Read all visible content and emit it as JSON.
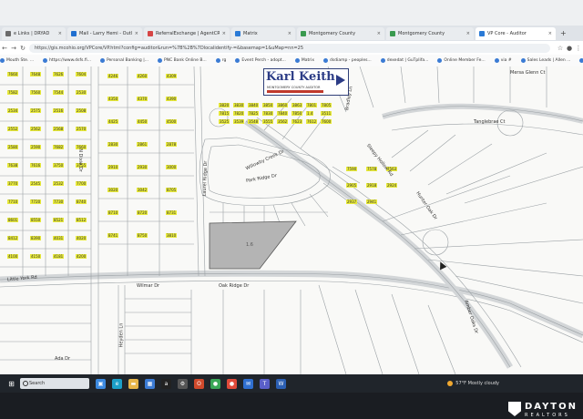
{
  "browser": {
    "top_left_label": "",
    "tabs": [
      {
        "label": "e Links | DRYAD",
        "color": "#6b6b6b"
      },
      {
        "label": "Mail - Larry Hemi - Outlook",
        "color": "#1f6fd0"
      },
      {
        "label": "ReferralExchange | AgentCRM",
        "color": "#d64545"
      },
      {
        "label": "Matrix",
        "color": "#2a7ad6"
      },
      {
        "label": "Montgomery County",
        "color": "#3a9a4f"
      },
      {
        "label": "Montgomery County",
        "color": "#3a9a4f"
      },
      {
        "label": "VP Core - Auditor",
        "color": "#2a7ad6"
      }
    ],
    "active_tab_index": 6,
    "url": "https://gis.mcohio.org/VPCore/VP.html?config=auditor&run=%7B%2B%7Dlocalidentify-=&basemap=1&uMap=nn=25",
    "bookmarks": [
      "Mouth Ste. ...",
      "https://www.dsfs.fi...",
      "Personal Banking |...",
      "PNC Bank Online B...",
      "rg",
      "Event Perch - adopt...",
      "Matrix",
      "dsdiamp - peoples...",
      "dexedat | GuTplifa...",
      "Online Member Fe...",
      "via #",
      "Sales Leads | Allen ...",
      "Lead Offers | Lou...",
      "XGL Mail (7)"
    ]
  },
  "map": {
    "logo": {
      "name": "Karl Keith",
      "subtitle": "MONTGOMERY COUNTY AUDITOR"
    },
    "streets": [
      "Willowby Creek Dr",
      "Park Ridge Dr",
      "Laurel Ridge Dr",
      "Hunter Oak Dr",
      "Sleepy Hollow Rd",
      "Little York Rd",
      "Ada Dr",
      "Heyden Ln",
      "Amber Oaks Dr",
      "Tanglebrae Ct",
      "Mersa Glenn Ct",
      "N Dixie Dr",
      "Bradley Ln",
      "Wilmar Dr",
      "Oak Ridge Dr"
    ],
    "parcel_labels": [
      "7660",
      "7648",
      "7626",
      "7604",
      "7582",
      "7560",
      "7544",
      "2530",
      "2534",
      "2575",
      "2516",
      "2508",
      "2552",
      "2562",
      "2568",
      "2570",
      "2580",
      "2590",
      "7682",
      "7660",
      "7638",
      "7616",
      "3750",
      "3755",
      "3770",
      "2545",
      "2532",
      "7700",
      "7710",
      "7720",
      "7730",
      "8740",
      "8601",
      "8550",
      "8521",
      "8512",
      "8412",
      "8390",
      "4031",
      "4020",
      "4100",
      "4150",
      "4181",
      "4200",
      "4246",
      "4260",
      "4309",
      "4350",
      "4370",
      "4390",
      "4425",
      "4450",
      "4500",
      "2830",
      "2861",
      "2878",
      "2910",
      "2930",
      "3000",
      "3020",
      "3042",
      "8705",
      "8710",
      "8720",
      "8731",
      "8741",
      "8750",
      "3810",
      "3820",
      "3830",
      "3840",
      "3850",
      "3860",
      "3863",
      "7801",
      "7805",
      "7815",
      "7820",
      "7825",
      "7830",
      "7840",
      "7850",
      "1.4",
      "3511",
      "3525",
      "3539",
      "3548",
      "3555",
      "3562",
      "7623",
      "7612",
      "7600",
      "7590",
      "7578",
      "7563",
      "2905",
      "2918",
      "2924",
      "2937",
      "2941"
    ],
    "highlighted_parcel": {
      "label": "1.6",
      "color": "#b4b4b4"
    }
  },
  "taskbar": {
    "search_placeholder": "Search",
    "weather": "57°F  Mostly cloudy",
    "apps": [
      {
        "name": "task-view-icon",
        "color": "#3c8ae0",
        "glyph": "▣"
      },
      {
        "name": "edge-icon",
        "color": "#1ca0c8",
        "glyph": "e"
      },
      {
        "name": "file-explorer-icon",
        "color": "#e8b64a",
        "glyph": "▬"
      },
      {
        "name": "store-icon",
        "color": "#3b7bd4",
        "glyph": "▦"
      },
      {
        "name": "amazon-icon",
        "color": "#222222",
        "glyph": "a"
      },
      {
        "name": "settings-icon",
        "color": "#555555",
        "glyph": "⚙"
      },
      {
        "name": "office-icon",
        "color": "#d04a2c",
        "glyph": "O"
      },
      {
        "name": "chrome-icon",
        "color": "#3aa757",
        "glyph": "●"
      },
      {
        "name": "chrome-profile-icon",
        "color": "#e04a3a",
        "glyph": "●"
      },
      {
        "name": "mail-icon",
        "color": "#2f6fd0",
        "glyph": "✉"
      },
      {
        "name": "teams-icon",
        "color": "#5a5fc8",
        "glyph": "T"
      },
      {
        "name": "word-icon",
        "color": "#2b5fb3",
        "glyph": "W"
      }
    ]
  },
  "watermark": {
    "line1": "DAYTON",
    "line2": "REALTORS"
  }
}
